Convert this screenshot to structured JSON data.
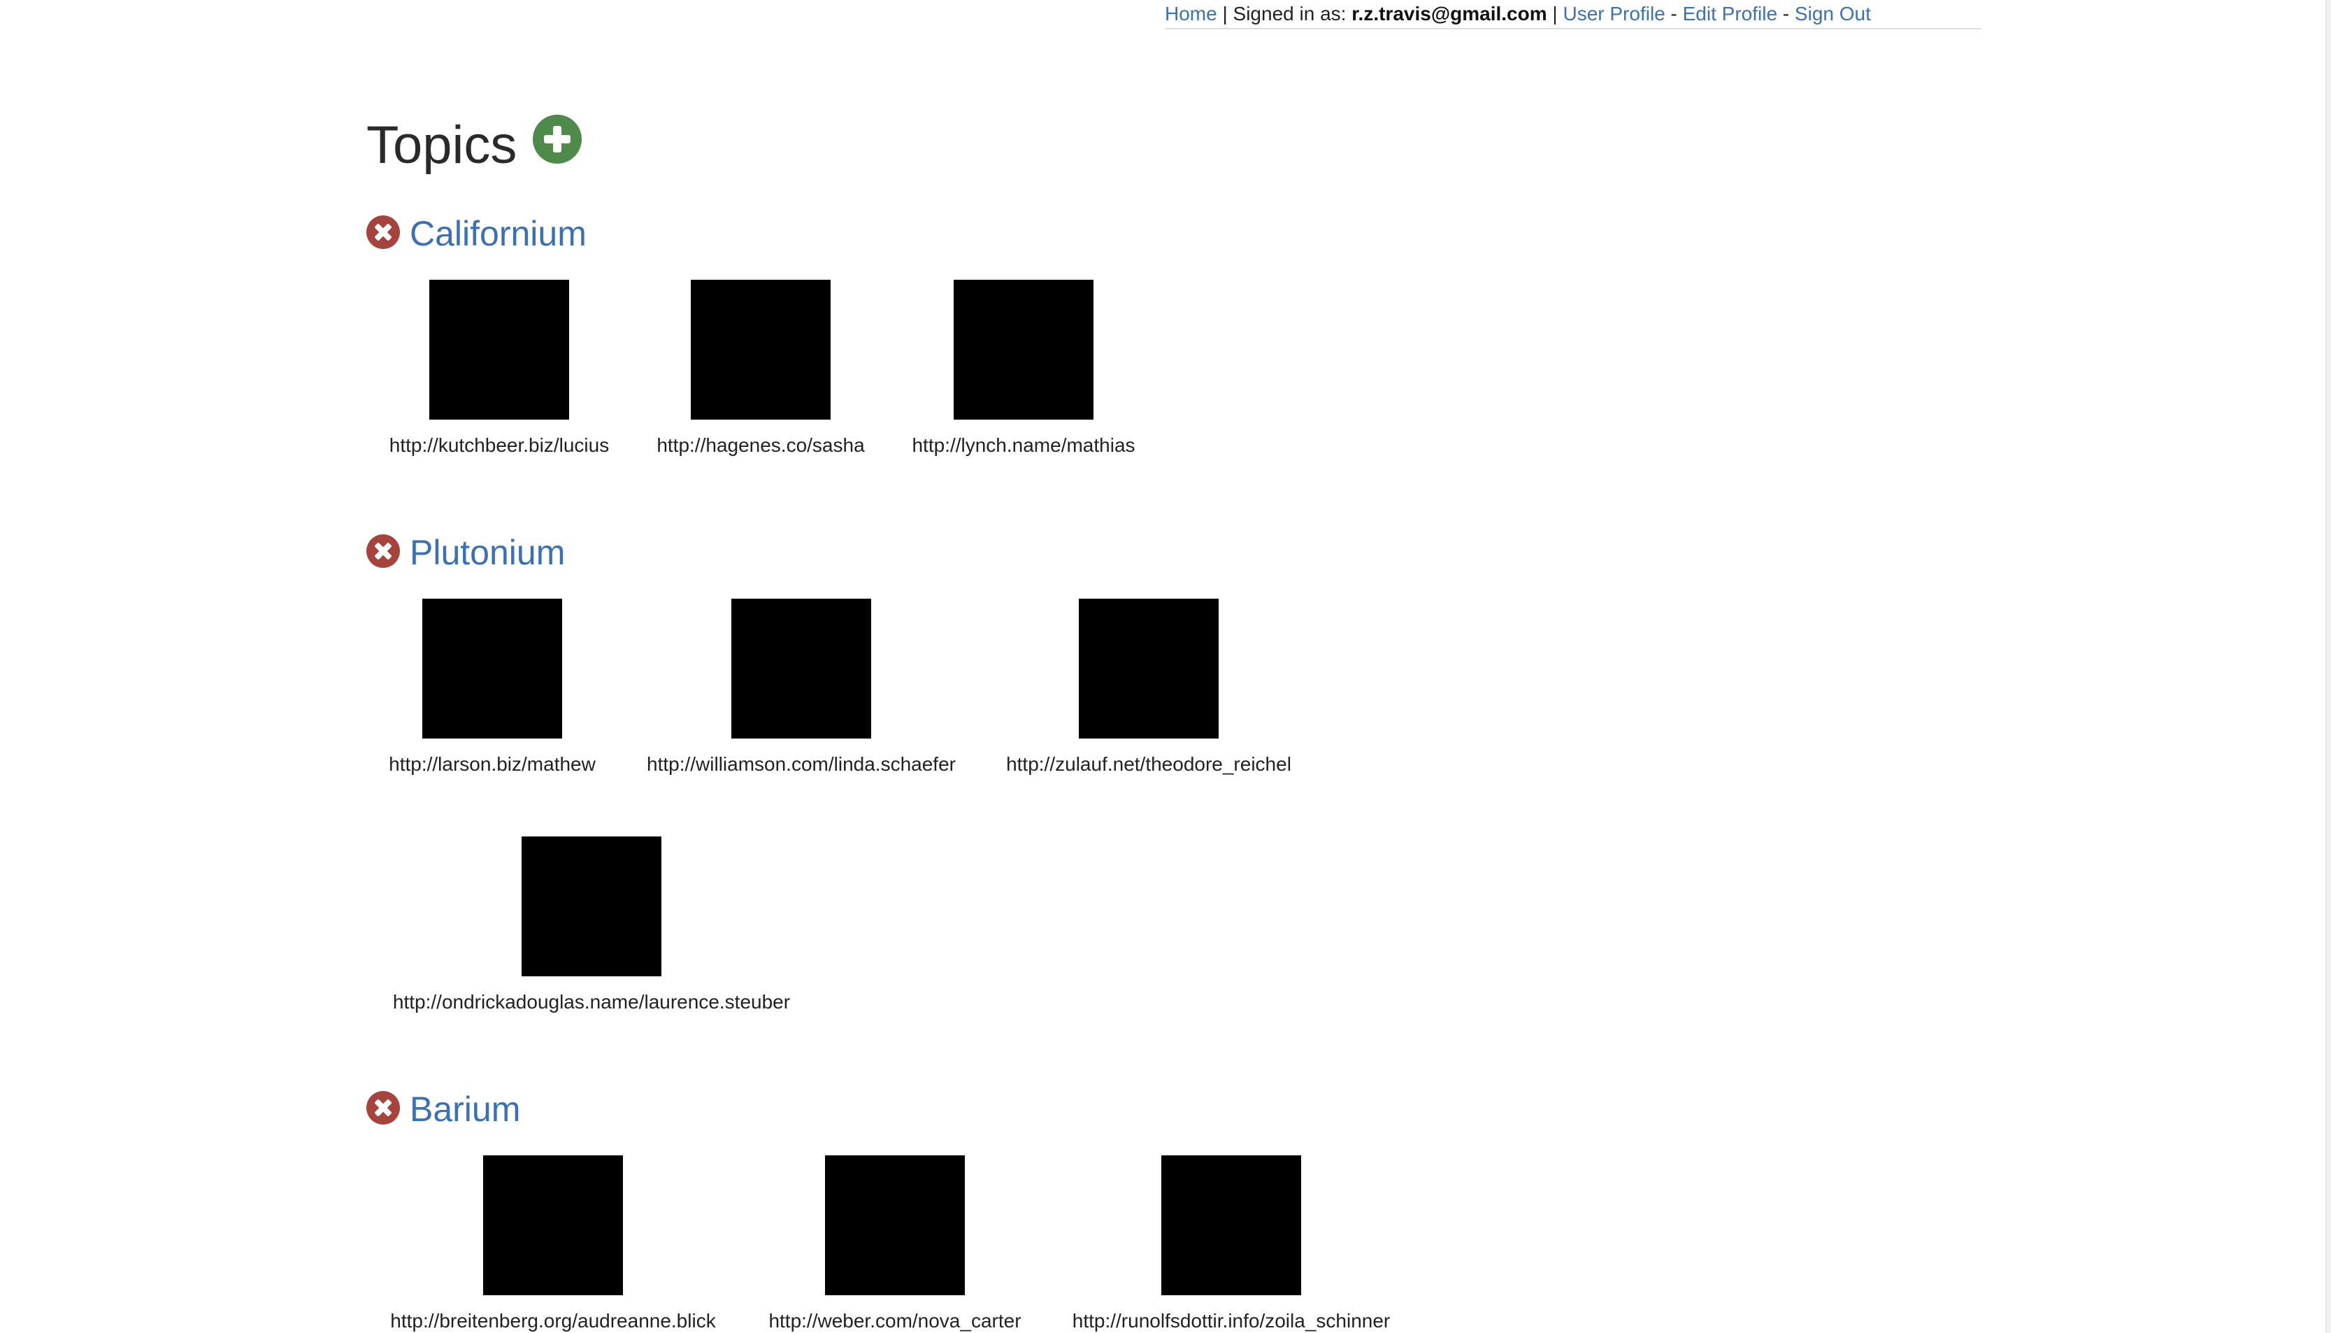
{
  "nav": {
    "home": "Home",
    "sep1": " | Signed in as: ",
    "email": "r.z.travis@gmail.com",
    "sep2": " | ",
    "user_profile": "User Profile",
    "sep3": " - ",
    "edit_profile": "Edit Profile",
    "sep4": " - ",
    "sign_out": "Sign Out"
  },
  "page": {
    "title": "Topics",
    "add_icon": "plus-circle-icon",
    "delete_icon": "x-circle-icon",
    "colors": {
      "link": "#3a71b6",
      "add": "#4e8a4a",
      "delete": "#a7433d",
      "thumbnail": "#000000"
    }
  },
  "topics": [
    {
      "name": "Californium",
      "entries": [
        {
          "url": "http://kutchbeer.biz/lucius"
        },
        {
          "url": "http://hagenes.co/sasha"
        },
        {
          "url": "http://lynch.name/mathias"
        }
      ]
    },
    {
      "name": "Plutonium",
      "entries": [
        {
          "url": "http://larson.biz/mathew"
        },
        {
          "url": "http://williamson.com/linda.schaefer"
        },
        {
          "url": "http://zulauf.net/theodore_reichel"
        },
        {
          "url": "http://ondrickadouglas.name/laurence.steuber"
        }
      ]
    },
    {
      "name": "Barium",
      "entries": [
        {
          "url": "http://breitenberg.org/audreanne.blick"
        },
        {
          "url": "http://weber.com/nova_carter"
        },
        {
          "url": "http://runolfsdottir.info/zoila_schinner"
        }
      ]
    }
  ]
}
